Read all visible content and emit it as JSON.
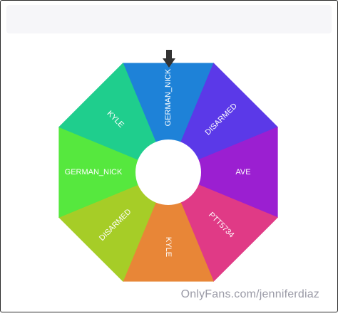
{
  "wheel": {
    "segments": [
      {
        "label": "GERMAN_NICK",
        "color": "#1e82d8"
      },
      {
        "label": "DISARMED",
        "color": "#5b39e8"
      },
      {
        "label": "AVE",
        "color": "#9b1fd1"
      },
      {
        "label": "PTT5734",
        "color": "#e03a86"
      },
      {
        "label": "KYLE",
        "color": "#e88637"
      },
      {
        "label": "DISARMED",
        "color": "#a6cd27"
      },
      {
        "label": "GERMAN_NICK",
        "color": "#56e83e"
      },
      {
        "label": "KYLE",
        "color": "#1fce8d"
      }
    ],
    "pointer_icon": "down-arrow-icon",
    "pointer_color": "#333333",
    "hub_color": "#ffffff",
    "label_color": "#ffffff"
  },
  "watermark": {
    "text": "OnlyFans.com/jenniferdiaz"
  }
}
